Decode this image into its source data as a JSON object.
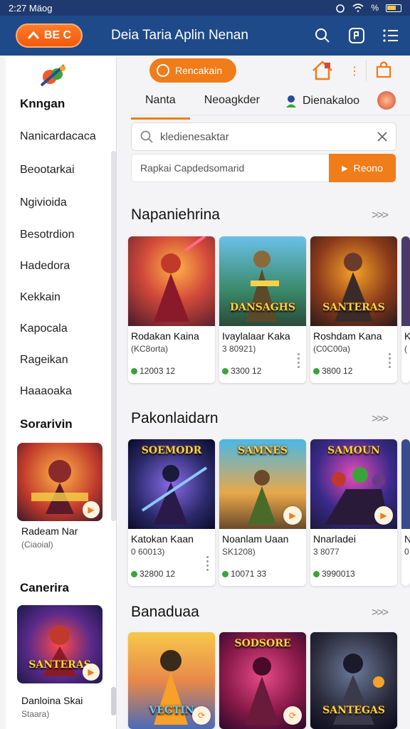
{
  "status": {
    "time": "2:27 Mäog"
  },
  "appbar": {
    "brand": "BE C",
    "title": "Deia Taria Aplin Nenan",
    "icons": [
      "search-icon",
      "tab-switcher-icon",
      "menu-icon"
    ]
  },
  "sidebar": {
    "heading": "Knngan",
    "items": [
      "Nanicardacaca",
      "Beootarkai",
      "Ngivioida",
      "Besotrdion",
      "Hadedora",
      "Kekkain",
      "Kapocala",
      "Rageikan",
      "Haaaoaka"
    ],
    "section2": "Sorarivin",
    "card1": {
      "title": "Radeam Nar",
      "sub": "(Ciaoial)"
    },
    "section3": "Canerira",
    "card2": {
      "title": "Danloina Skai",
      "sub": "Staara)",
      "art_label": "SANTERAS"
    }
  },
  "main": {
    "chip": "Rencakain",
    "tabs": [
      "Nanta",
      "Neoagkder",
      "Dienakaloo"
    ],
    "search": {
      "value": "kledienesaktar"
    },
    "promo": {
      "text": "Rapkai Capdedsomarid",
      "button": "Reono"
    },
    "sections": [
      {
        "title": "Napaniehrina",
        "more": ">>>",
        "cards": [
          {
            "title": "Rodakan Kaina",
            "sub": "(KC8orta)",
            "stat": "12003 12",
            "art_label": ""
          },
          {
            "title": "Ivaylalaar Kaka",
            "sub": "3 80921)",
            "stat": "3300 12",
            "art_label": "DANSAGHS"
          },
          {
            "title": "Roshdam Kana",
            "sub": "(C0C00a)",
            "stat": "3800 12",
            "art_label": "SANTERAS"
          },
          {
            "title": "K",
            "sub": "(",
            "stat": "",
            "art_label": ""
          }
        ]
      },
      {
        "title": "Pakonlaidarn",
        "more": ">>>",
        "cards": [
          {
            "title": "Katokan Kaan",
            "sub": "0 60013)",
            "stat": "32800 12",
            "art_label": "SOEMODR"
          },
          {
            "title": "Noanlam Uaan",
            "sub": "SK1208)",
            "stat": "10071 33",
            "art_label": "SAMNES"
          },
          {
            "title": "Nnarladei",
            "sub": "3 8077",
            "stat": "3990013",
            "art_label": "SAMOUN"
          },
          {
            "title": "N",
            "sub": "0",
            "stat": "",
            "art_label": ""
          }
        ]
      },
      {
        "title": "Banaduaa",
        "more": ">>>",
        "cards": [
          {
            "title": "",
            "sub": "",
            "stat": "",
            "art_label": "VEGTIN"
          },
          {
            "title": "",
            "sub": "",
            "stat": "",
            "art_label": "SODSORE"
          },
          {
            "title": "",
            "sub": "",
            "stat": "",
            "art_label": "SANTEGAS"
          }
        ]
      }
    ]
  },
  "colors": {
    "appbar": "#1f4a8a",
    "accent": "#f07c1a",
    "statusbar": "#1e3a6e"
  }
}
